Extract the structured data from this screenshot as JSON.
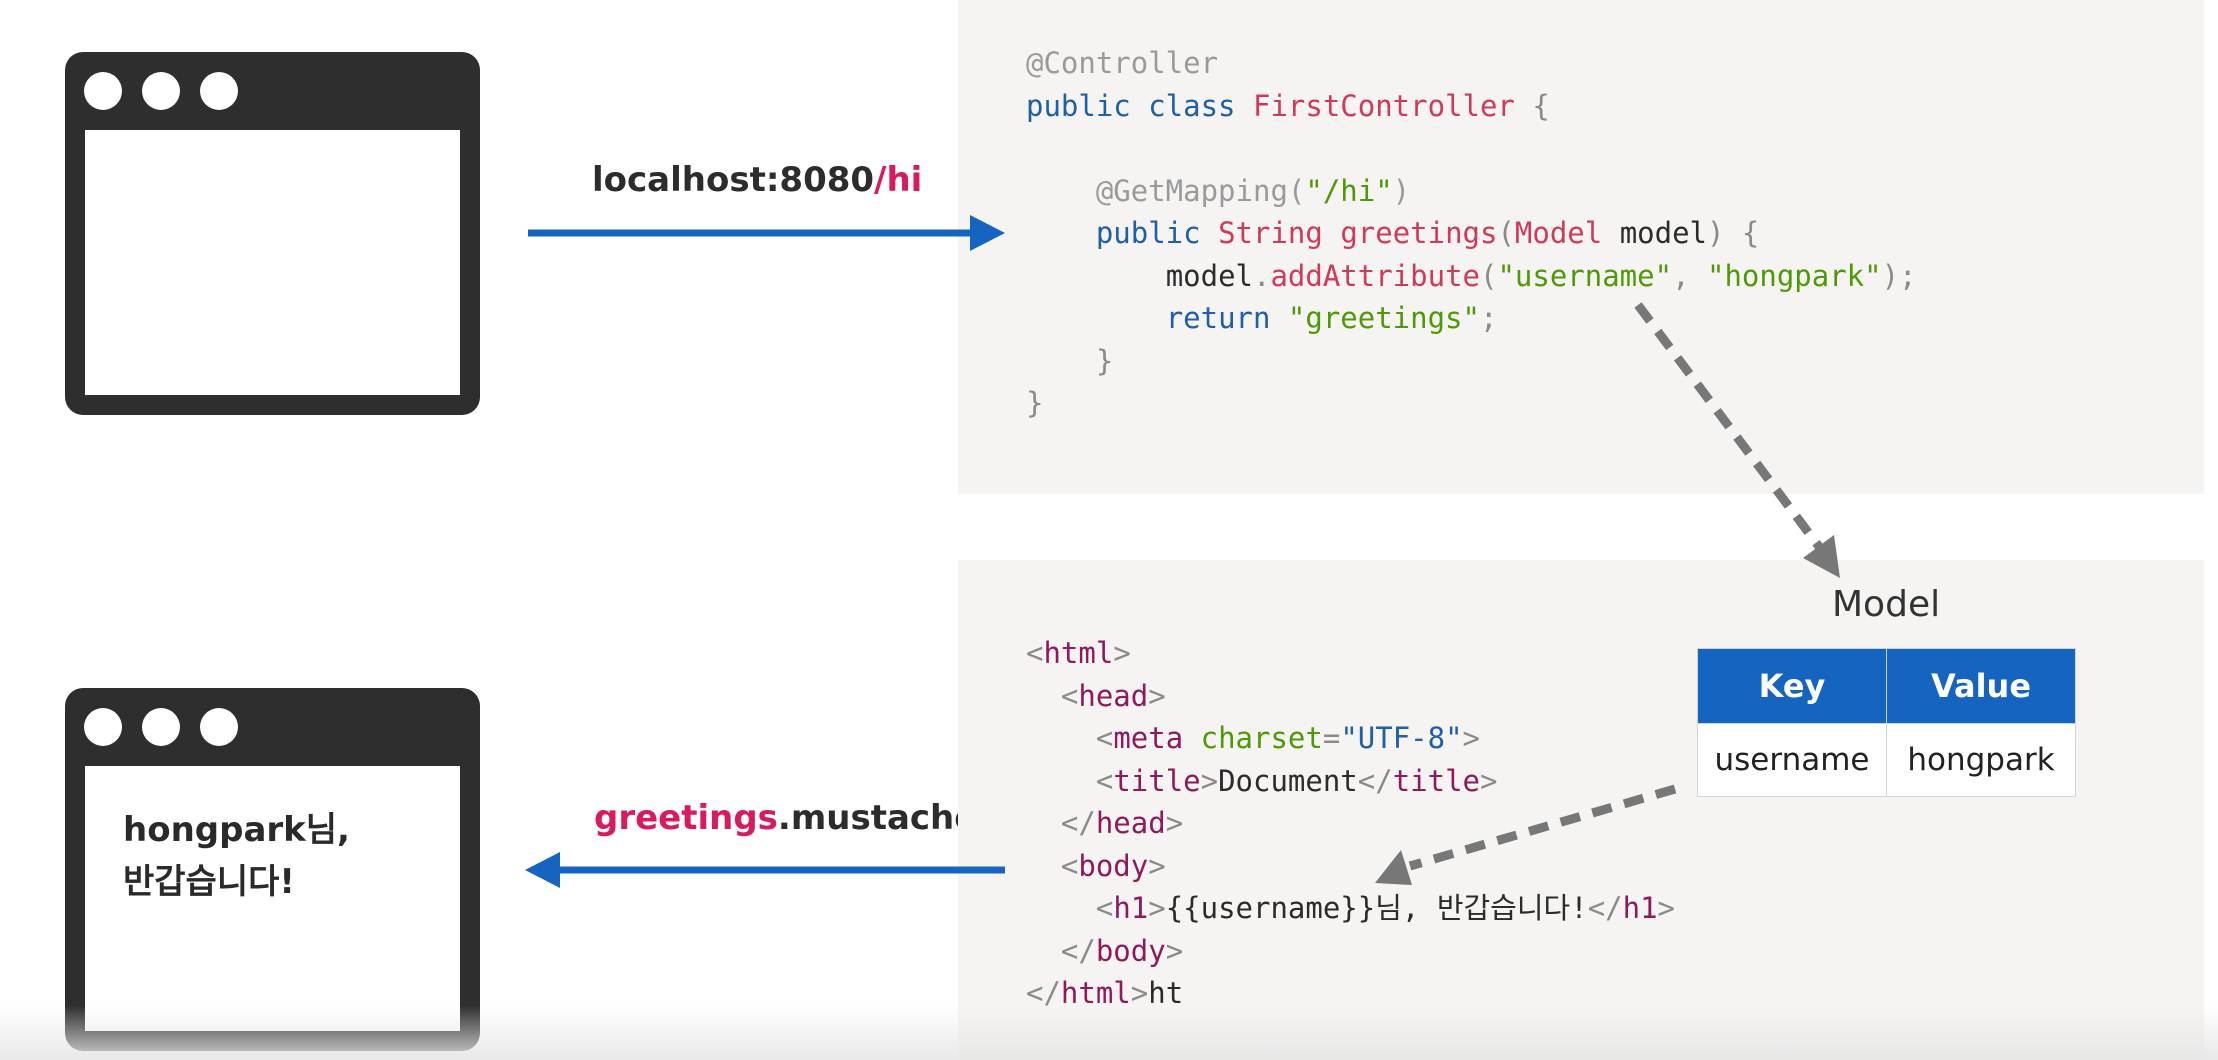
{
  "top_label": {
    "host": "localhost:8080",
    "path": "/hi"
  },
  "bottom_label": {
    "name": "greetings",
    "ext": ".mustache"
  },
  "browser_bottom": {
    "line1": "hongpark님,",
    "line2": "반갑습니다!"
  },
  "controller_code": {
    "annotation": "@Controller",
    "class_kw": "public class",
    "class_name": "FirstController",
    "brace_open": "{",
    "mapping_ann": "@GetMapping(",
    "mapping_path": "\"/hi\"",
    "mapping_close": ")",
    "method_kw": "public",
    "method_type": "String",
    "method_name": "greetings",
    "param_paren": "(",
    "param_type": "Model",
    "param_name": "model",
    "param_close": ") {",
    "call_obj": "model",
    "call_dot": ".",
    "call_method": "addAttribute",
    "call_open": "(",
    "call_key": "\"username\"",
    "call_comma": ", ",
    "call_value": "\"hongpark\"",
    "call_close": ");",
    "return_kw": "return",
    "return_value": "\"greetings\"",
    "semicolon": ";",
    "brace_close": "}"
  },
  "template_code": {
    "lt": "<",
    "gt": ">",
    "lt_slash": "</",
    "html": "html",
    "head": "head",
    "meta": "meta",
    "charset_attr": "charset",
    "eq": "=",
    "charset_val": "\"UTF-8\"",
    "title": "title",
    "title_text": "Document",
    "body": "body",
    "h1": "h1",
    "h1_text": "{{username}}님, 반갑습니다!",
    "trailing": "ht"
  },
  "model": {
    "title": "Model",
    "headers": [
      "Key",
      "Value"
    ],
    "rows": [
      [
        "username",
        "hongpark"
      ]
    ]
  },
  "colors": {
    "arrow_blue": "#1565c0",
    "dashed_gray": "#777777",
    "highlight_pink": "#d81b60",
    "table_header": "#1565c0"
  }
}
